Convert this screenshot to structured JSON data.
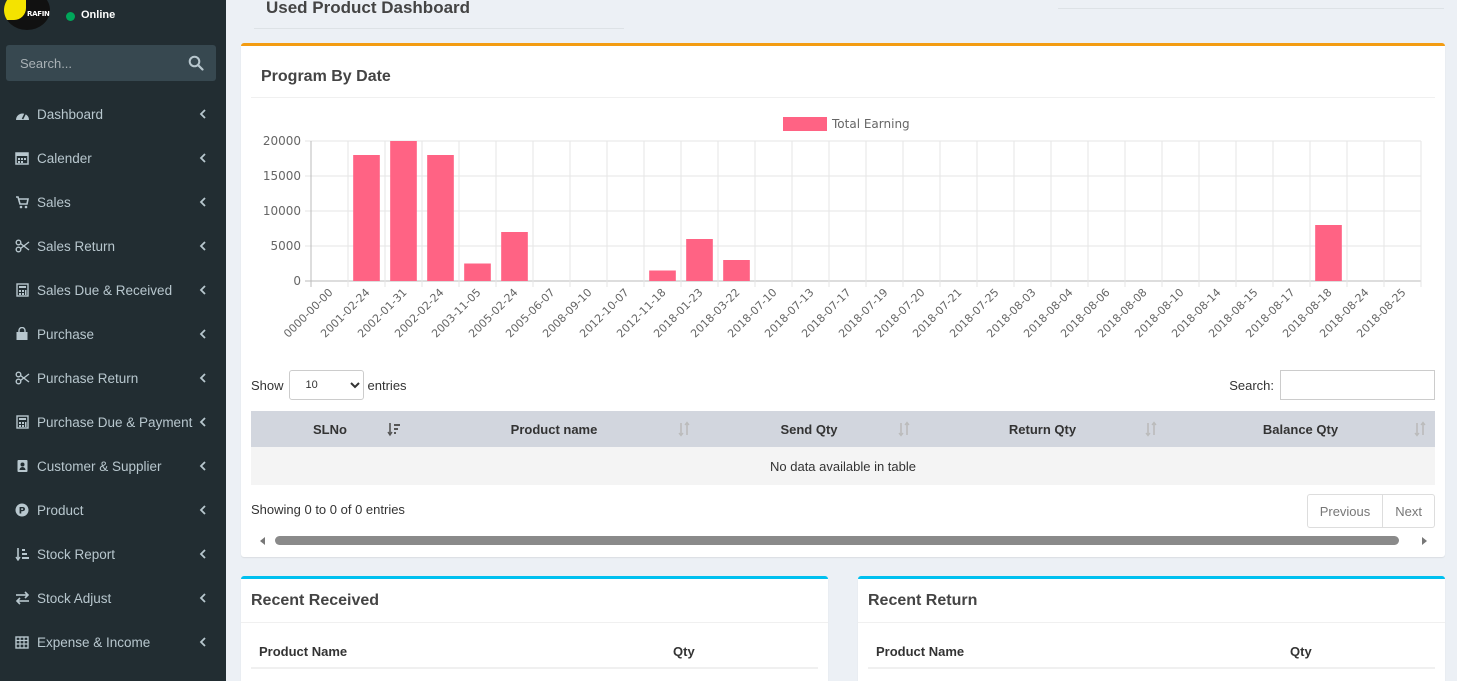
{
  "sidebar": {
    "status": "Online",
    "logo_text": "RAFIN",
    "search_placeholder": "Search...",
    "items": [
      {
        "label": "Dashboard",
        "icon": "dashboard-icon"
      },
      {
        "label": "Calender",
        "icon": "calendar-icon"
      },
      {
        "label": "Sales",
        "icon": "cart-icon"
      },
      {
        "label": "Sales Return",
        "icon": "scissors-icon"
      },
      {
        "label": "Sales Due & Received",
        "icon": "calculator-icon"
      },
      {
        "label": "Purchase",
        "icon": "shopping-bag-icon"
      },
      {
        "label": "Purchase Return",
        "icon": "scissors-icon"
      },
      {
        "label": "Purchase Due & Payment",
        "icon": "calculator-icon"
      },
      {
        "label": "Customer & Supplier",
        "icon": "address-book-icon"
      },
      {
        "label": "Product",
        "icon": "product-p-icon"
      },
      {
        "label": "Stock Report",
        "icon": "sort-amount-icon"
      },
      {
        "label": "Stock Adjust",
        "icon": "exchange-icon"
      },
      {
        "label": "Expense & Income",
        "icon": "table-icon"
      }
    ]
  },
  "header": {
    "title": "Used Product Dashboard"
  },
  "program_box": {
    "title": "Program By Date"
  },
  "chart_data": {
    "type": "bar",
    "legend": [
      "Total Earning"
    ],
    "legend_placement": "top",
    "bar_color": "#ff6384",
    "ylim": [
      0,
      20000
    ],
    "yticks": [
      0,
      5000,
      10000,
      15000,
      20000
    ],
    "grid": true,
    "categories": [
      "0000-00-00",
      "2001-02-24",
      "2002-01-31",
      "2002-02-24",
      "2003-11-05",
      "2005-02-24",
      "2005-06-07",
      "2008-09-10",
      "2012-10-07",
      "2012-11-18",
      "2018-01-23",
      "2018-03-22",
      "2018-07-10",
      "2018-07-13",
      "2018-07-17",
      "2018-07-19",
      "2018-07-20",
      "2018-07-21",
      "2018-07-25",
      "2018-08-03",
      "2018-08-04",
      "2018-08-06",
      "2018-08-08",
      "2018-08-10",
      "2018-08-14",
      "2018-08-15",
      "2018-08-17",
      "2018-08-18",
      "2018-08-24",
      "2018-08-25"
    ],
    "series": [
      {
        "name": "Total Earning",
        "values": [
          0,
          18000,
          20000,
          18000,
          2500,
          7000,
          0,
          0,
          0,
          1500,
          6000,
          3000,
          0,
          0,
          0,
          0,
          0,
          0,
          0,
          0,
          0,
          0,
          0,
          0,
          0,
          0,
          0,
          8000,
          0,
          0
        ]
      }
    ]
  },
  "table": {
    "show_label": "Show",
    "entries_label": "entries",
    "page_size": "10",
    "search_label": "Search:",
    "columns": [
      "SLNo",
      "Product name",
      "Send Qty",
      "Return Qty",
      "Balance Qty"
    ],
    "empty_text": "No data available in table",
    "info": "Showing 0 to 0 of 0 entries",
    "prev_label": "Previous",
    "next_label": "Next"
  },
  "recent_received": {
    "title": "Recent Received",
    "col_product": "Product Name",
    "col_qty": "Qty"
  },
  "recent_return": {
    "title": "Recent Return",
    "col_product": "Product Name",
    "col_qty": "Qty"
  }
}
